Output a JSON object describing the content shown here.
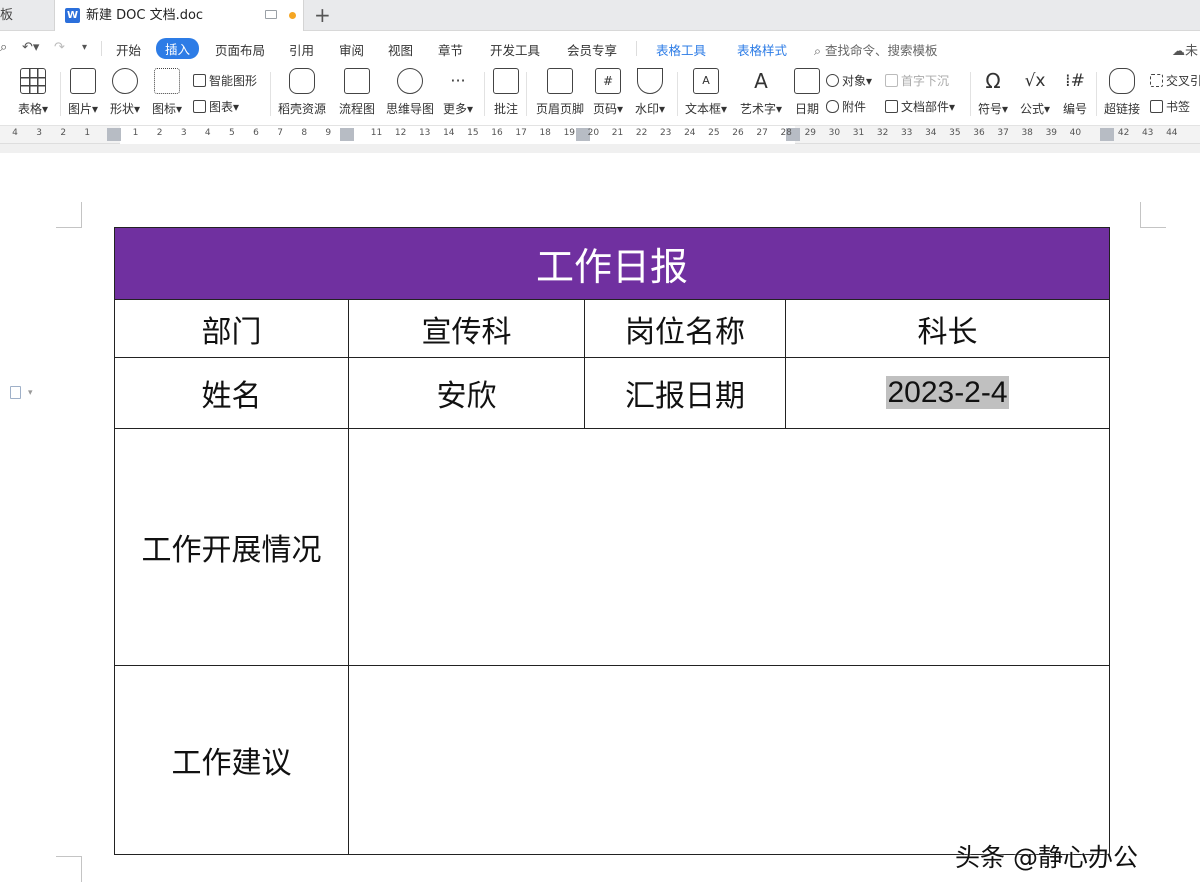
{
  "tabs": {
    "prev_tab_label": "板",
    "active_tab_title": "新建 DOC 文档.doc",
    "add_tab": "+"
  },
  "menu": {
    "items": [
      "开始",
      "插入",
      "页面布局",
      "引用",
      "审阅",
      "视图",
      "章节",
      "开发工具",
      "会员专享",
      "表格工具",
      "表格样式"
    ],
    "active": "插入",
    "search_placeholder": "查找命令、搜索模板",
    "cloud_label": "未"
  },
  "ribbon": {
    "table": "表格",
    "picture": "图片",
    "shape": "形状",
    "icon": "图标",
    "smart_shape": "智能图形",
    "chart": "图表",
    "daoke": "稻壳资源",
    "flowchart": "流程图",
    "mindmap": "思维导图",
    "more": "更多",
    "comment": "批注",
    "header_footer": "页眉页脚",
    "page_number": "页码",
    "watermark": "水印",
    "textbox": "文本框",
    "wordart": "艺术字",
    "date": "日期",
    "object": "对象",
    "attachment": "附件",
    "dropcap": "首字下沉",
    "doc_parts": "文档部件",
    "symbol": "符号",
    "formula": "公式",
    "numbering": "编号",
    "hyperlink": "超链接",
    "cross_ref": "交叉引",
    "bookmark": "书签"
  },
  "ruler": {
    "ticks": [
      "4",
      "3",
      "2",
      "1",
      "",
      "1",
      "2",
      "3",
      "4",
      "5",
      "6",
      "7",
      "8",
      "9",
      "",
      "11",
      "12",
      "13",
      "14",
      "15",
      "16",
      "17",
      "18",
      "19",
      "20",
      "21",
      "22",
      "23",
      "24",
      "25",
      "26",
      "27",
      "28",
      "29",
      "30",
      "31",
      "32",
      "33",
      "34",
      "35",
      "36",
      "37",
      "38",
      "39",
      "40",
      "",
      "42",
      "43",
      "44"
    ]
  },
  "document": {
    "title": "工作日报",
    "dept_label": "部门",
    "dept_value": "宣传科",
    "position_label": "岗位名称",
    "position_value": "科长",
    "name_label": "姓名",
    "name_value": "安欣",
    "date_label": "汇报日期",
    "date_value": "2023-2-4",
    "work_label": "工作开展情况",
    "work_value": "",
    "suggestion_label": "工作建议",
    "suggestion_value": ""
  },
  "watermark_text": "头条 @静心办公",
  "colors": {
    "table_header_bg": "#7030a0",
    "selection_highlight": "#c0c0c0",
    "accent": "#2d7ce6"
  }
}
